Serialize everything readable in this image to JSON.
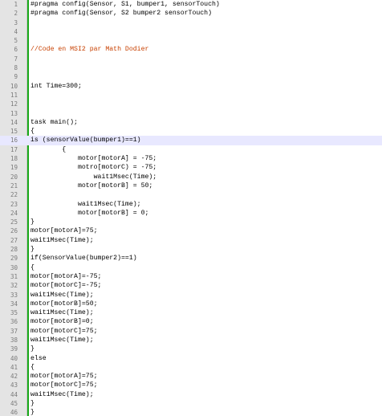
{
  "editor": {
    "colors": {
      "gutter_bg": "#e4e4e4",
      "change_bar": "#18a818",
      "current_line": "#e8e8ff",
      "comment": "#c84000",
      "text": "#000000"
    },
    "current_line": 16,
    "lines": [
      {
        "n": "1",
        "text": "#pragma config(Sensor, S1, bumper1, sensorTouch)"
      },
      {
        "n": "2",
        "text": "#pragma config(Sensor, S2 bumper2 sensorTouch)"
      },
      {
        "n": "3",
        "text": ""
      },
      {
        "n": "4",
        "text": ""
      },
      {
        "n": "5",
        "text": ""
      },
      {
        "n": "6",
        "text": "//Code en MSI2 par Math Dodier",
        "type": "comment"
      },
      {
        "n": "7",
        "text": ""
      },
      {
        "n": "8",
        "text": ""
      },
      {
        "n": "9",
        "text": ""
      },
      {
        "n": "10",
        "text": "int Time=300;"
      },
      {
        "n": "11",
        "text": ""
      },
      {
        "n": "12",
        "text": ""
      },
      {
        "n": "13",
        "text": ""
      },
      {
        "n": "14",
        "text": "task main();"
      },
      {
        "n": "15",
        "text": "{"
      },
      {
        "n": "16",
        "text": "is (sensorValue(bumper1)==1)"
      },
      {
        "n": "17",
        "text": "        {"
      },
      {
        "n": "18",
        "text": "            motor[motorA] = -75;"
      },
      {
        "n": "19",
        "text": "            motro[motorC) = -75;"
      },
      {
        "n": "20",
        "text": "                wait1Msec(Time);"
      },
      {
        "n": "21",
        "text": "            motor[motorB] = 50;"
      },
      {
        "n": "22",
        "text": ""
      },
      {
        "n": "23",
        "text": "            wait1Msec(Time);"
      },
      {
        "n": "24",
        "text": "            motor[motorB] = 0;"
      },
      {
        "n": "25",
        "text": "}"
      },
      {
        "n": "26",
        "text": "motor[motorA]=75;"
      },
      {
        "n": "27",
        "text": "wait1Msec(Time);"
      },
      {
        "n": "28",
        "text": "}"
      },
      {
        "n": "29",
        "text": "if(SensorValue(bumper2)==1)"
      },
      {
        "n": "30",
        "text": "{"
      },
      {
        "n": "31",
        "text": "motor[motorA]=-75;"
      },
      {
        "n": "32",
        "text": "motor[motorC]=-75;"
      },
      {
        "n": "33",
        "text": "wait1Msec(Time);"
      },
      {
        "n": "34",
        "text": "motor[motorB]=50;"
      },
      {
        "n": "35",
        "text": "wait1Msec(Time);"
      },
      {
        "n": "36",
        "text": "motor[motorB]=0;"
      },
      {
        "n": "37",
        "text": "motor[motorC]=75;"
      },
      {
        "n": "38",
        "text": "wait1Msec(Time);"
      },
      {
        "n": "39",
        "text": "}"
      },
      {
        "n": "40",
        "text": "else"
      },
      {
        "n": "41",
        "text": "{"
      },
      {
        "n": "42",
        "text": "motor[motorA]=75;"
      },
      {
        "n": "43",
        "text": "motor[motorC]=75;"
      },
      {
        "n": "44",
        "text": "wait1Msec(Time);"
      },
      {
        "n": "45",
        "text": "}"
      },
      {
        "n": "46",
        "text": "}"
      }
    ]
  }
}
